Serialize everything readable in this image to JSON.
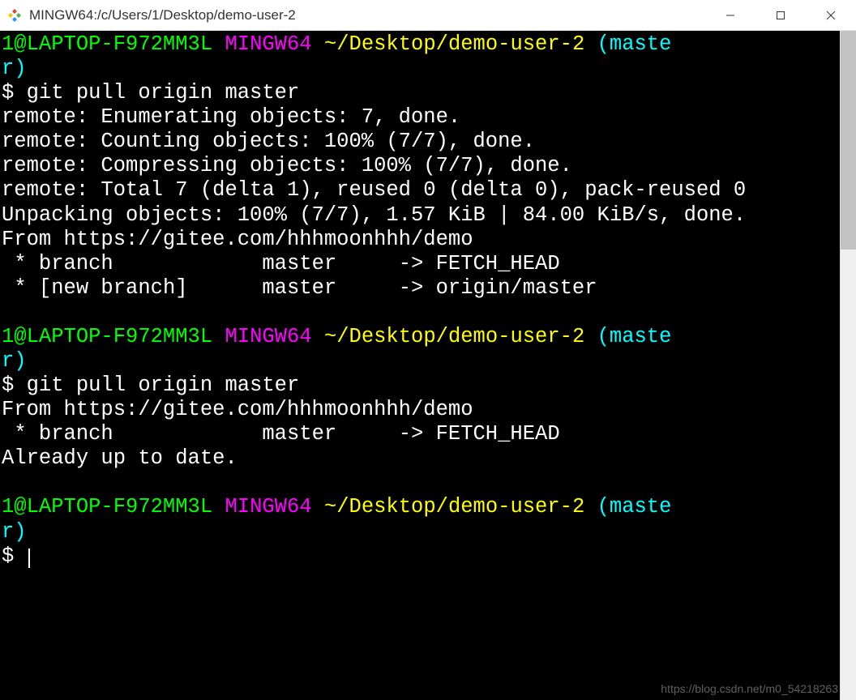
{
  "window": {
    "title": "MINGW64:/c/Users/1/Desktop/demo-user-2"
  },
  "prompt": {
    "user_host": "1@LAPTOP-F972MM3L",
    "shell": "MINGW64",
    "tilde": "~",
    "path": "/Desktop/demo-user-2",
    "branch_open": "(maste",
    "branch_close": "r)",
    "dollar": "$ ",
    "space": " "
  },
  "commands": {
    "cmd1": "git pull origin master",
    "cmd2": "git pull origin master"
  },
  "output1": {
    "l1": "remote: Enumerating objects: 7, done.",
    "l2": "remote: Counting objects: 100% (7/7), done.",
    "l3": "remote: Compressing objects: 100% (7/7), done.",
    "l4": "remote: Total 7 (delta 1), reused 0 (delta 0), pack-reused 0",
    "l5": "Unpacking objects: 100% (7/7), 1.57 KiB | 84.00 KiB/s, done.",
    "l6": "From https://gitee.com/hhhmoonhhh/demo",
    "l7": " * branch            master     -> FETCH_HEAD",
    "l8": " * [new branch]      master     -> origin/master"
  },
  "output2": {
    "l1": "From https://gitee.com/hhhmoonhhh/demo",
    "l2": " * branch            master     -> FETCH_HEAD",
    "l3": "Already up to date."
  },
  "watermark": "https://blog.csdn.net/m0_54218263"
}
